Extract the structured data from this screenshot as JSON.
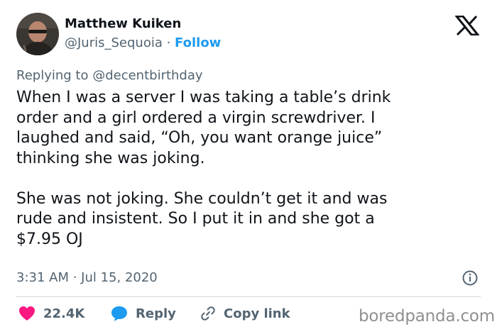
{
  "author": {
    "name": "Matthew Kuiken",
    "handle": "@Juris_Sequoia",
    "separator": " · ",
    "follow_label": "Follow"
  },
  "reply": {
    "prefix": "Replying to ",
    "mention": "@decentbirthday"
  },
  "tweet": {
    "text": "When I was a server I was taking a table’s drink\norder and a girl ordered a virgin screwdriver. I\nlaughed and said, “Oh, you want orange juice”\nthinking she was joking.\n\nShe was not joking. She couldn’t get it and was\nrude and insistent. So I put it in and she got a\n$7.95 OJ",
    "timestamp": "3:31 AM · Jul 15, 2020"
  },
  "actions": {
    "like_count": "22.4K",
    "reply_label": "Reply",
    "copy_link_label": "Copy link"
  },
  "watermark": "boredpanda.com",
  "colors": {
    "like": "#f91880",
    "reply": "#1d9bf0",
    "follow": "#1d9bf0",
    "muted": "#536471",
    "text": "#0f1419"
  },
  "icons": [
    "x-logo-icon",
    "info-icon",
    "heart-icon",
    "reply-bubble-icon",
    "link-icon"
  ]
}
